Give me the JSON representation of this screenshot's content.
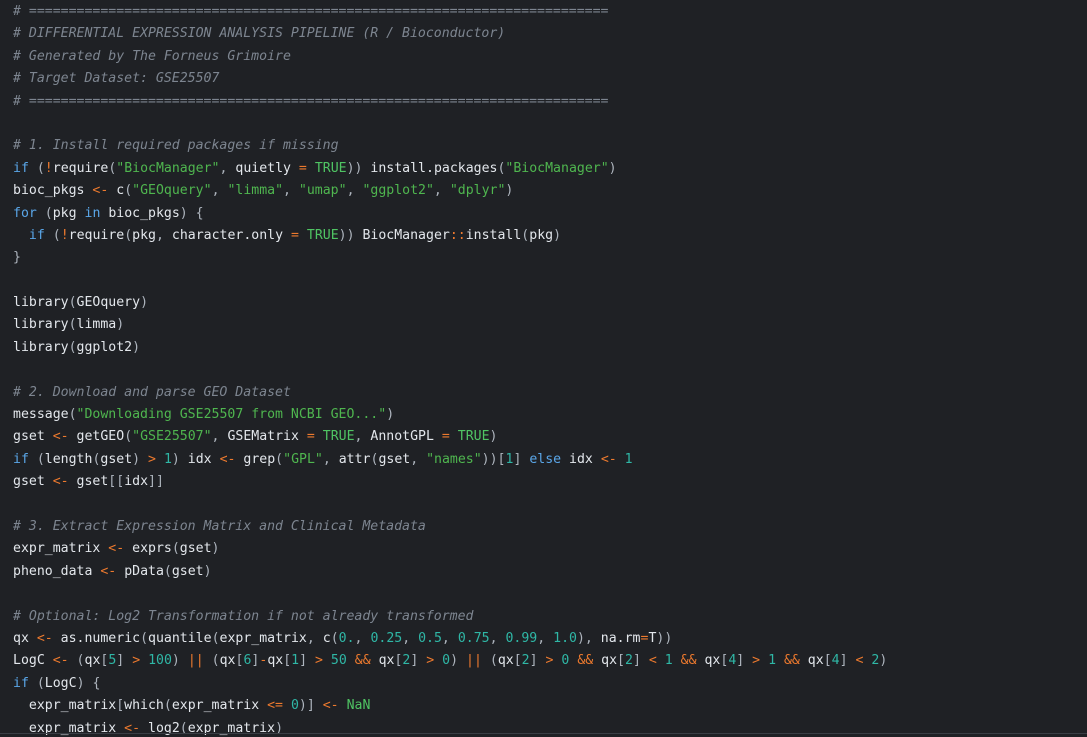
{
  "editor": {
    "language": "R",
    "colors": {
      "background": "#1f2125",
      "comment": "#7d8590",
      "keyword": "#5aa6e8",
      "string": "#4fb64f",
      "operator": "#ee7a2e",
      "number": "#2fb7a6",
      "boolean": "#4fc463",
      "plain": "#e3e7ec"
    },
    "lines": [
      [
        {
          "t": "cm",
          "v": "# ========================================================================="
        }
      ],
      [
        {
          "t": "cm",
          "v": "# DIFFERENTIAL EXPRESSION ANALYSIS PIPELINE (R / Bioconductor)"
        }
      ],
      [
        {
          "t": "cm",
          "v": "# Generated by The Forneus Grimoire"
        }
      ],
      [
        {
          "t": "cm",
          "v": "# Target Dataset: GSE25507"
        }
      ],
      [
        {
          "t": "cm",
          "v": "# ========================================================================="
        }
      ],
      [],
      [
        {
          "t": "cm",
          "v": "# 1. Install required packages if missing"
        }
      ],
      [
        {
          "t": "kw",
          "v": "if"
        },
        {
          "t": "pl",
          "v": " "
        },
        {
          "t": "pu",
          "v": "("
        },
        {
          "t": "op",
          "v": "!"
        },
        {
          "t": "fn",
          "v": "require"
        },
        {
          "t": "pu",
          "v": "("
        },
        {
          "t": "st",
          "v": "\"BiocManager\""
        },
        {
          "t": "pu",
          "v": ", "
        },
        {
          "t": "pl",
          "v": "quietly "
        },
        {
          "t": "op",
          "v": "="
        },
        {
          "t": "pl",
          "v": " "
        },
        {
          "t": "bo",
          "v": "TRUE"
        },
        {
          "t": "pu",
          "v": ")) "
        },
        {
          "t": "fn",
          "v": "install.packages"
        },
        {
          "t": "pu",
          "v": "("
        },
        {
          "t": "st",
          "v": "\"BiocManager\""
        },
        {
          "t": "pu",
          "v": ")"
        }
      ],
      [
        {
          "t": "pl",
          "v": "bioc_pkgs "
        },
        {
          "t": "op",
          "v": "<-"
        },
        {
          "t": "pl",
          "v": " "
        },
        {
          "t": "fn",
          "v": "c"
        },
        {
          "t": "pu",
          "v": "("
        },
        {
          "t": "st",
          "v": "\"GEOquery\""
        },
        {
          "t": "pu",
          "v": ", "
        },
        {
          "t": "st",
          "v": "\"limma\""
        },
        {
          "t": "pu",
          "v": ", "
        },
        {
          "t": "st",
          "v": "\"umap\""
        },
        {
          "t": "pu",
          "v": ", "
        },
        {
          "t": "st",
          "v": "\"ggplot2\""
        },
        {
          "t": "pu",
          "v": ", "
        },
        {
          "t": "st",
          "v": "\"dplyr\""
        },
        {
          "t": "pu",
          "v": ")"
        }
      ],
      [
        {
          "t": "kw",
          "v": "for"
        },
        {
          "t": "pl",
          "v": " "
        },
        {
          "t": "pu",
          "v": "("
        },
        {
          "t": "pl",
          "v": "pkg "
        },
        {
          "t": "kw",
          "v": "in"
        },
        {
          "t": "pl",
          "v": " bioc_pkgs"
        },
        {
          "t": "pu",
          "v": ") {"
        }
      ],
      [
        {
          "t": "pl",
          "v": "  "
        },
        {
          "t": "kw",
          "v": "if"
        },
        {
          "t": "pl",
          "v": " "
        },
        {
          "t": "pu",
          "v": "("
        },
        {
          "t": "op",
          "v": "!"
        },
        {
          "t": "fn",
          "v": "require"
        },
        {
          "t": "pu",
          "v": "("
        },
        {
          "t": "pl",
          "v": "pkg"
        },
        {
          "t": "pu",
          "v": ", "
        },
        {
          "t": "pl",
          "v": "character.only "
        },
        {
          "t": "op",
          "v": "="
        },
        {
          "t": "pl",
          "v": " "
        },
        {
          "t": "bo",
          "v": "TRUE"
        },
        {
          "t": "pu",
          "v": ")) "
        },
        {
          "t": "fn",
          "v": "BiocManager"
        },
        {
          "t": "op",
          "v": "::"
        },
        {
          "t": "fn",
          "v": "install"
        },
        {
          "t": "pu",
          "v": "("
        },
        {
          "t": "pl",
          "v": "pkg"
        },
        {
          "t": "pu",
          "v": ")"
        }
      ],
      [
        {
          "t": "pu",
          "v": "}"
        }
      ],
      [],
      [
        {
          "t": "fn",
          "v": "library"
        },
        {
          "t": "pu",
          "v": "("
        },
        {
          "t": "pl",
          "v": "GEOquery"
        },
        {
          "t": "pu",
          "v": ")"
        }
      ],
      [
        {
          "t": "fn",
          "v": "library"
        },
        {
          "t": "pu",
          "v": "("
        },
        {
          "t": "pl",
          "v": "limma"
        },
        {
          "t": "pu",
          "v": ")"
        }
      ],
      [
        {
          "t": "fn",
          "v": "library"
        },
        {
          "t": "pu",
          "v": "("
        },
        {
          "t": "pl",
          "v": "ggplot2"
        },
        {
          "t": "pu",
          "v": ")"
        }
      ],
      [],
      [
        {
          "t": "cm",
          "v": "# 2. Download and parse GEO Dataset"
        }
      ],
      [
        {
          "t": "fn",
          "v": "message"
        },
        {
          "t": "pu",
          "v": "("
        },
        {
          "t": "st",
          "v": "\"Downloading GSE25507 from NCBI GEO...\""
        },
        {
          "t": "pu",
          "v": ")"
        }
      ],
      [
        {
          "t": "pl",
          "v": "gset "
        },
        {
          "t": "op",
          "v": "<-"
        },
        {
          "t": "pl",
          "v": " "
        },
        {
          "t": "fn",
          "v": "getGEO"
        },
        {
          "t": "pu",
          "v": "("
        },
        {
          "t": "st",
          "v": "\"GSE25507\""
        },
        {
          "t": "pu",
          "v": ", "
        },
        {
          "t": "pl",
          "v": "GSEMatrix "
        },
        {
          "t": "op",
          "v": "="
        },
        {
          "t": "pl",
          "v": " "
        },
        {
          "t": "bo",
          "v": "TRUE"
        },
        {
          "t": "pu",
          "v": ", "
        },
        {
          "t": "pl",
          "v": "AnnotGPL "
        },
        {
          "t": "op",
          "v": "="
        },
        {
          "t": "pl",
          "v": " "
        },
        {
          "t": "bo",
          "v": "TRUE"
        },
        {
          "t": "pu",
          "v": ")"
        }
      ],
      [
        {
          "t": "kw",
          "v": "if"
        },
        {
          "t": "pl",
          "v": " "
        },
        {
          "t": "pu",
          "v": "("
        },
        {
          "t": "fn",
          "v": "length"
        },
        {
          "t": "pu",
          "v": "("
        },
        {
          "t": "pl",
          "v": "gset"
        },
        {
          "t": "pu",
          "v": ") "
        },
        {
          "t": "op",
          "v": ">"
        },
        {
          "t": "pl",
          "v": " "
        },
        {
          "t": "nu",
          "v": "1"
        },
        {
          "t": "pu",
          "v": ") "
        },
        {
          "t": "pl",
          "v": "idx "
        },
        {
          "t": "op",
          "v": "<-"
        },
        {
          "t": "pl",
          "v": " "
        },
        {
          "t": "fn",
          "v": "grep"
        },
        {
          "t": "pu",
          "v": "("
        },
        {
          "t": "st",
          "v": "\"GPL\""
        },
        {
          "t": "pu",
          "v": ", "
        },
        {
          "t": "fn",
          "v": "attr"
        },
        {
          "t": "pu",
          "v": "("
        },
        {
          "t": "pl",
          "v": "gset"
        },
        {
          "t": "pu",
          "v": ", "
        },
        {
          "t": "st",
          "v": "\"names\""
        },
        {
          "t": "pu",
          "v": "))["
        },
        {
          "t": "nu",
          "v": "1"
        },
        {
          "t": "pu",
          "v": "] "
        },
        {
          "t": "kw",
          "v": "else"
        },
        {
          "t": "pl",
          "v": " idx "
        },
        {
          "t": "op",
          "v": "<-"
        },
        {
          "t": "pl",
          "v": " "
        },
        {
          "t": "nu",
          "v": "1"
        }
      ],
      [
        {
          "t": "pl",
          "v": "gset "
        },
        {
          "t": "op",
          "v": "<-"
        },
        {
          "t": "pl",
          "v": " gset"
        },
        {
          "t": "pu",
          "v": "[["
        },
        {
          "t": "pl",
          "v": "idx"
        },
        {
          "t": "pu",
          "v": "]]"
        }
      ],
      [],
      [
        {
          "t": "cm",
          "v": "# 3. Extract Expression Matrix and Clinical Metadata"
        }
      ],
      [
        {
          "t": "pl",
          "v": "expr_matrix "
        },
        {
          "t": "op",
          "v": "<-"
        },
        {
          "t": "pl",
          "v": " "
        },
        {
          "t": "fn",
          "v": "exprs"
        },
        {
          "t": "pu",
          "v": "("
        },
        {
          "t": "pl",
          "v": "gset"
        },
        {
          "t": "pu",
          "v": ")"
        }
      ],
      [
        {
          "t": "pl",
          "v": "pheno_data "
        },
        {
          "t": "op",
          "v": "<-"
        },
        {
          "t": "pl",
          "v": " "
        },
        {
          "t": "fn",
          "v": "pData"
        },
        {
          "t": "pu",
          "v": "("
        },
        {
          "t": "pl",
          "v": "gset"
        },
        {
          "t": "pu",
          "v": ")"
        }
      ],
      [],
      [
        {
          "t": "cm",
          "v": "# Optional: Log2 Transformation if not already transformed"
        }
      ],
      [
        {
          "t": "pl",
          "v": "qx "
        },
        {
          "t": "op",
          "v": "<-"
        },
        {
          "t": "pl",
          "v": " "
        },
        {
          "t": "fn",
          "v": "as.numeric"
        },
        {
          "t": "pu",
          "v": "("
        },
        {
          "t": "fn",
          "v": "quantile"
        },
        {
          "t": "pu",
          "v": "("
        },
        {
          "t": "pl",
          "v": "expr_matrix"
        },
        {
          "t": "pu",
          "v": ", "
        },
        {
          "t": "fn",
          "v": "c"
        },
        {
          "t": "pu",
          "v": "("
        },
        {
          "t": "nu",
          "v": "0."
        },
        {
          "t": "pu",
          "v": ", "
        },
        {
          "t": "nu",
          "v": "0.25"
        },
        {
          "t": "pu",
          "v": ", "
        },
        {
          "t": "nu",
          "v": "0.5"
        },
        {
          "t": "pu",
          "v": ", "
        },
        {
          "t": "nu",
          "v": "0.75"
        },
        {
          "t": "pu",
          "v": ", "
        },
        {
          "t": "nu",
          "v": "0.99"
        },
        {
          "t": "pu",
          "v": ", "
        },
        {
          "t": "nu",
          "v": "1.0"
        },
        {
          "t": "pu",
          "v": "), "
        },
        {
          "t": "pl",
          "v": "na.rm"
        },
        {
          "t": "op",
          "v": "="
        },
        {
          "t": "pl",
          "v": "T"
        },
        {
          "t": "pu",
          "v": "))"
        }
      ],
      [
        {
          "t": "pl",
          "v": "LogC "
        },
        {
          "t": "op",
          "v": "<-"
        },
        {
          "t": "pl",
          "v": " "
        },
        {
          "t": "pu",
          "v": "("
        },
        {
          "t": "pl",
          "v": "qx"
        },
        {
          "t": "pu",
          "v": "["
        },
        {
          "t": "nu",
          "v": "5"
        },
        {
          "t": "pu",
          "v": "] "
        },
        {
          "t": "op",
          "v": ">"
        },
        {
          "t": "pl",
          "v": " "
        },
        {
          "t": "nu",
          "v": "100"
        },
        {
          "t": "pu",
          "v": ") "
        },
        {
          "t": "op",
          "v": "||"
        },
        {
          "t": "pl",
          "v": " "
        },
        {
          "t": "pu",
          "v": "("
        },
        {
          "t": "pl",
          "v": "qx"
        },
        {
          "t": "pu",
          "v": "["
        },
        {
          "t": "nu",
          "v": "6"
        },
        {
          "t": "pu",
          "v": "]"
        },
        {
          "t": "op",
          "v": "-"
        },
        {
          "t": "pl",
          "v": "qx"
        },
        {
          "t": "pu",
          "v": "["
        },
        {
          "t": "nu",
          "v": "1"
        },
        {
          "t": "pu",
          "v": "] "
        },
        {
          "t": "op",
          "v": ">"
        },
        {
          "t": "pl",
          "v": " "
        },
        {
          "t": "nu",
          "v": "50"
        },
        {
          "t": "pl",
          "v": " "
        },
        {
          "t": "op",
          "v": "&&"
        },
        {
          "t": "pl",
          "v": " qx"
        },
        {
          "t": "pu",
          "v": "["
        },
        {
          "t": "nu",
          "v": "2"
        },
        {
          "t": "pu",
          "v": "] "
        },
        {
          "t": "op",
          "v": ">"
        },
        {
          "t": "pl",
          "v": " "
        },
        {
          "t": "nu",
          "v": "0"
        },
        {
          "t": "pu",
          "v": ") "
        },
        {
          "t": "op",
          "v": "||"
        },
        {
          "t": "pl",
          "v": " "
        },
        {
          "t": "pu",
          "v": "("
        },
        {
          "t": "pl",
          "v": "qx"
        },
        {
          "t": "pu",
          "v": "["
        },
        {
          "t": "nu",
          "v": "2"
        },
        {
          "t": "pu",
          "v": "] "
        },
        {
          "t": "op",
          "v": ">"
        },
        {
          "t": "pl",
          "v": " "
        },
        {
          "t": "nu",
          "v": "0"
        },
        {
          "t": "pl",
          "v": " "
        },
        {
          "t": "op",
          "v": "&&"
        },
        {
          "t": "pl",
          "v": " qx"
        },
        {
          "t": "pu",
          "v": "["
        },
        {
          "t": "nu",
          "v": "2"
        },
        {
          "t": "pu",
          "v": "] "
        },
        {
          "t": "op",
          "v": "<"
        },
        {
          "t": "pl",
          "v": " "
        },
        {
          "t": "nu",
          "v": "1"
        },
        {
          "t": "pl",
          "v": " "
        },
        {
          "t": "op",
          "v": "&&"
        },
        {
          "t": "pl",
          "v": " qx"
        },
        {
          "t": "pu",
          "v": "["
        },
        {
          "t": "nu",
          "v": "4"
        },
        {
          "t": "pu",
          "v": "] "
        },
        {
          "t": "op",
          "v": ">"
        },
        {
          "t": "pl",
          "v": " "
        },
        {
          "t": "nu",
          "v": "1"
        },
        {
          "t": "pl",
          "v": " "
        },
        {
          "t": "op",
          "v": "&&"
        },
        {
          "t": "pl",
          "v": " qx"
        },
        {
          "t": "pu",
          "v": "["
        },
        {
          "t": "nu",
          "v": "4"
        },
        {
          "t": "pu",
          "v": "] "
        },
        {
          "t": "op",
          "v": "<"
        },
        {
          "t": "pl",
          "v": " "
        },
        {
          "t": "nu",
          "v": "2"
        },
        {
          "t": "pu",
          "v": ")"
        }
      ],
      [
        {
          "t": "kw",
          "v": "if"
        },
        {
          "t": "pl",
          "v": " "
        },
        {
          "t": "pu",
          "v": "("
        },
        {
          "t": "pl",
          "v": "LogC"
        },
        {
          "t": "pu",
          "v": ") {"
        }
      ],
      [
        {
          "t": "pl",
          "v": "  expr_matrix"
        },
        {
          "t": "pu",
          "v": "["
        },
        {
          "t": "fn",
          "v": "which"
        },
        {
          "t": "pu",
          "v": "("
        },
        {
          "t": "pl",
          "v": "expr_matrix "
        },
        {
          "t": "op",
          "v": "<="
        },
        {
          "t": "pl",
          "v": " "
        },
        {
          "t": "nu",
          "v": "0"
        },
        {
          "t": "pu",
          "v": ")] "
        },
        {
          "t": "op",
          "v": "<-"
        },
        {
          "t": "pl",
          "v": " "
        },
        {
          "t": "bo",
          "v": "NaN"
        }
      ],
      [
        {
          "t": "pl",
          "v": "  expr_matrix "
        },
        {
          "t": "op",
          "v": "<-"
        },
        {
          "t": "pl",
          "v": " "
        },
        {
          "t": "fn",
          "v": "log2"
        },
        {
          "t": "pu",
          "v": "("
        },
        {
          "t": "pl",
          "v": "expr_matrix"
        },
        {
          "t": "pu",
          "v": ")"
        }
      ]
    ]
  }
}
